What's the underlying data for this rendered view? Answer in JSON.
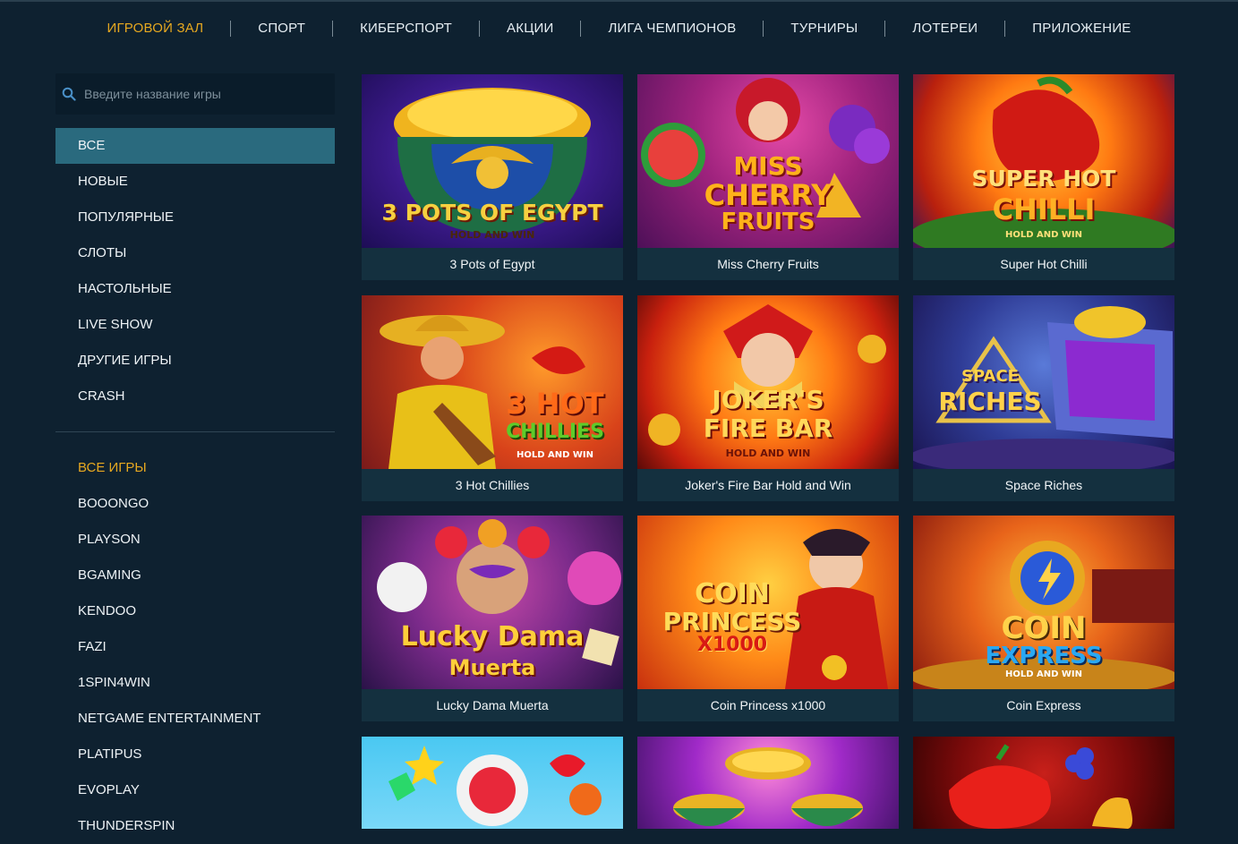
{
  "topnav": {
    "items": [
      "ИГРОВОЙ ЗАЛ",
      "СПОРТ",
      "КИБЕРСПОРТ",
      "АКЦИИ",
      "ЛИГА ЧЕМПИОНОВ",
      "ТУРНИРЫ",
      "ЛОТЕРЕИ",
      "ПРИЛОЖЕНИЕ"
    ],
    "active_index": 0
  },
  "search": {
    "placeholder": "Введите название игры",
    "value": ""
  },
  "categories": [
    "ВСЕ",
    "НОВЫЕ",
    "ПОПУЛЯРНЫЕ",
    "СЛОТЫ",
    "НАСТОЛЬНЫЕ",
    "LIVE SHOW",
    "ДРУГИЕ ИГРЫ",
    "CRASH"
  ],
  "active_category": 0,
  "providers": [
    "ВСЕ ИГРЫ",
    "BOOONGO",
    "PLAYSON",
    "BGAMING",
    "KENDOO",
    "FAZI",
    "1SPIN4WIN",
    "NETGAME ENTERTAINMENT",
    "PLATIPUS",
    "EVOPLAY",
    "THUNDERSPIN"
  ],
  "active_provider": 0,
  "games": [
    {
      "title": "3 Pots of Egypt",
      "art_lines": [
        "3 POTS OF EGYPT",
        "HOLD AND WIN"
      ]
    },
    {
      "title": "Miss Cherry Fruits",
      "art_lines": [
        "MISS",
        "CHERRY",
        "FRUITS"
      ]
    },
    {
      "title": "Super Hot Chilli",
      "art_lines": [
        "SUPER HOT",
        "CHILLI",
        "HOLD AND WIN"
      ]
    },
    {
      "title": "3 Hot Chillies",
      "art_lines": [
        "3 HOT",
        "CHILLIES",
        "HOLD AND WIN"
      ]
    },
    {
      "title": "Joker's Fire Bar Hold and Win",
      "art_lines": [
        "JOKER'S",
        "FIRE BAR",
        "HOLD AND WIN"
      ]
    },
    {
      "title": "Space Riches",
      "art_lines": [
        "SPACE",
        "RICHES"
      ]
    },
    {
      "title": "Lucky Dama Muerta",
      "art_lines": [
        "Lucky Dama",
        "Muerta"
      ]
    },
    {
      "title": "Coin Princess x1000",
      "art_lines": [
        "COIN",
        "PRINCESS",
        "X1000"
      ]
    },
    {
      "title": "Coin Express",
      "art_lines": [
        "COIN",
        "EXPRESS",
        "HOLD AND WIN"
      ]
    },
    {
      "title": "",
      "art_lines": []
    },
    {
      "title": "",
      "art_lines": []
    },
    {
      "title": "",
      "art_lines": []
    }
  ],
  "colors": {
    "background": "#0e2130",
    "accent": "#e6a820",
    "active_category_bg": "#2a6a7e",
    "caption_bg": "#14303f"
  },
  "icons": {
    "search": "search-icon"
  }
}
